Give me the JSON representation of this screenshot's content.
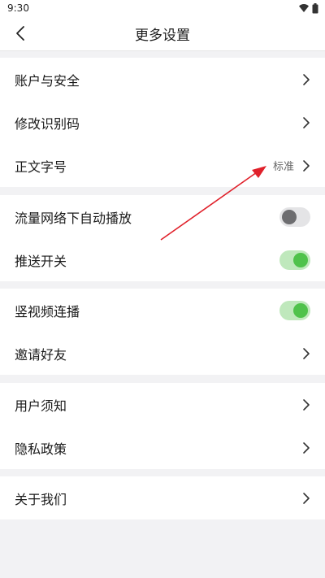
{
  "status_bar": {
    "time": "9:30"
  },
  "header": {
    "title": "更多设置"
  },
  "groups": [
    {
      "rows": [
        {
          "label": "账户与安全"
        },
        {
          "label": "修改识别码"
        },
        {
          "label": "正文字号",
          "value": "标准"
        }
      ]
    },
    {
      "rows": [
        {
          "label": "流量网络下自动播放",
          "toggle": "off"
        },
        {
          "label": "推送开关",
          "toggle": "on"
        }
      ]
    },
    {
      "rows": [
        {
          "label": "竖视频连播",
          "toggle": "on"
        },
        {
          "label": "邀请好友"
        }
      ]
    },
    {
      "rows": [
        {
          "label": "用户须知"
        },
        {
          "label": "隐私政策"
        }
      ]
    },
    {
      "rows": [
        {
          "label": "关于我们"
        }
      ]
    }
  ],
  "colors": {
    "accent_green": "#4fc24b",
    "annotation_arrow": "#e0202a"
  },
  "icons": [
    "back-icon",
    "chevron-right-icon",
    "wifi-icon",
    "battery-icon"
  ]
}
